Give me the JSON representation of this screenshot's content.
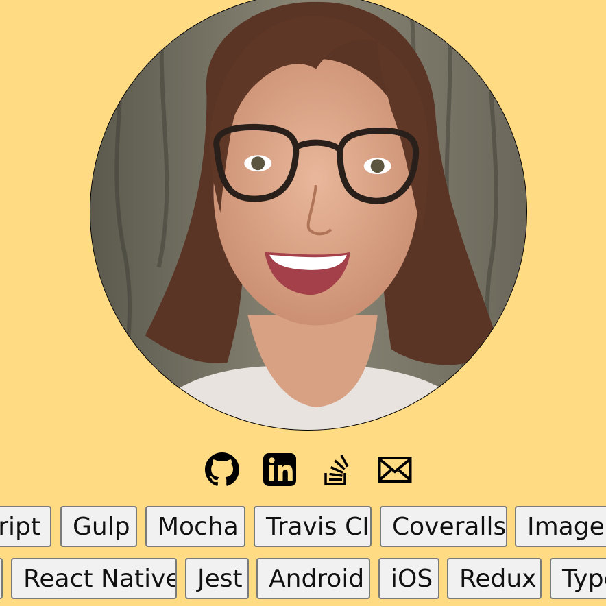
{
  "colors": {
    "page_background": "#ffdb83",
    "tag_background": "#f1f1f1",
    "tag_border": "#7a7a7a",
    "icon": "#000000"
  },
  "social": [
    {
      "icon": "github-icon",
      "label": "GitHub"
    },
    {
      "icon": "linkedin-icon",
      "label": "LinkedIn"
    },
    {
      "icon": "stackoverflow-icon",
      "label": "Stack Overflow"
    },
    {
      "icon": "email-icon",
      "label": "Email"
    }
  ],
  "tags_row1": [
    "ript",
    "Gulp",
    "Mocha",
    "Travis CI",
    "Coveralls",
    "ImageM"
  ],
  "tags_row2": [
    "",
    "React Native",
    "Jest",
    "Android",
    "iOS",
    "Redux",
    "Type"
  ]
}
